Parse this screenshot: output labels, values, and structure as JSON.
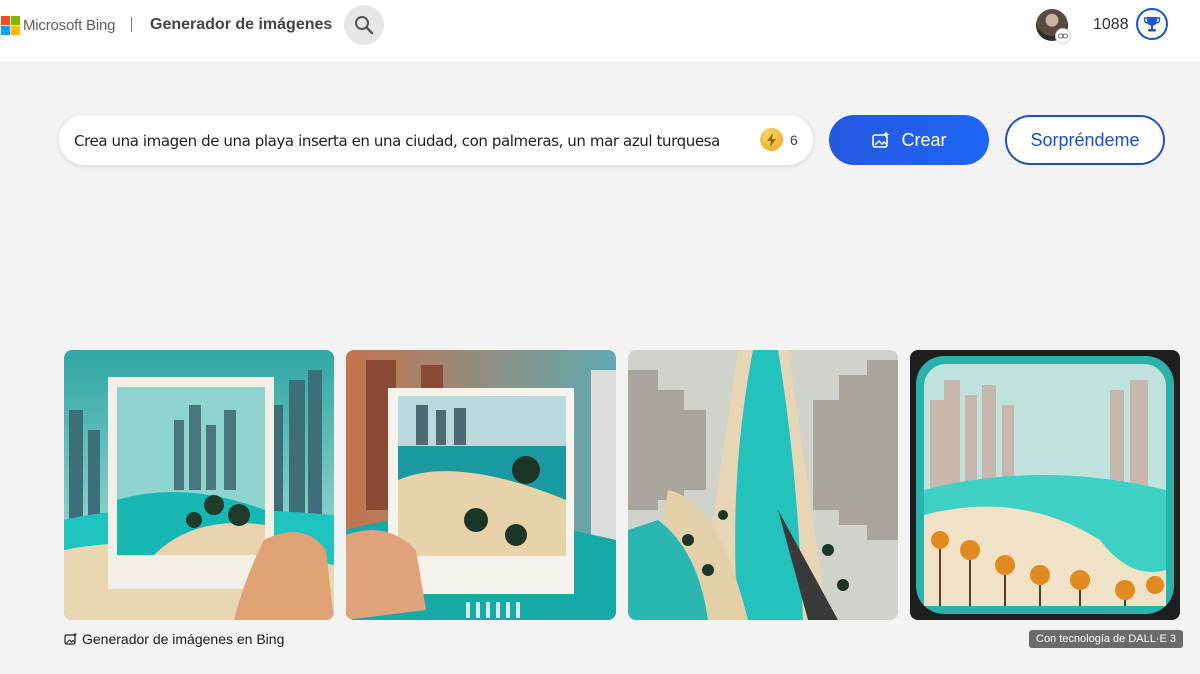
{
  "header": {
    "brand": "Microsoft Bing",
    "app_title": "Generador de imágenes",
    "points": "1088",
    "icons": [
      "microsoft-logo",
      "search-icon",
      "avatar",
      "link-icon",
      "trophy-icon"
    ]
  },
  "prompt": {
    "value": "Crea una imagen de una playa inserta en una ciudad, con palmeras, un mar azul turquesa",
    "boost_count": "6",
    "create_label": "Crear",
    "surprise_label": "Sorpréndeme"
  },
  "results": {
    "images": [
      {
        "alt": "Mano sosteniendo una foto instantánea de una playa con rascacielos"
      },
      {
        "alt": "Mano sosteniendo una foto instantánea de playa con palmeras"
      },
      {
        "alt": "Vista aérea de una playa turquesa entre edificios de la ciudad"
      },
      {
        "alt": "Playa con palmeras y rascacielos en estilo de foto antigua"
      }
    ],
    "caption": "Generador de imágenes en Bing",
    "powered_by": "Con tecnología de DALL·E 3"
  },
  "colors": {
    "accent": "#1e66f5",
    "outline": "#1c4fc9",
    "background": "#f3f3f3"
  }
}
